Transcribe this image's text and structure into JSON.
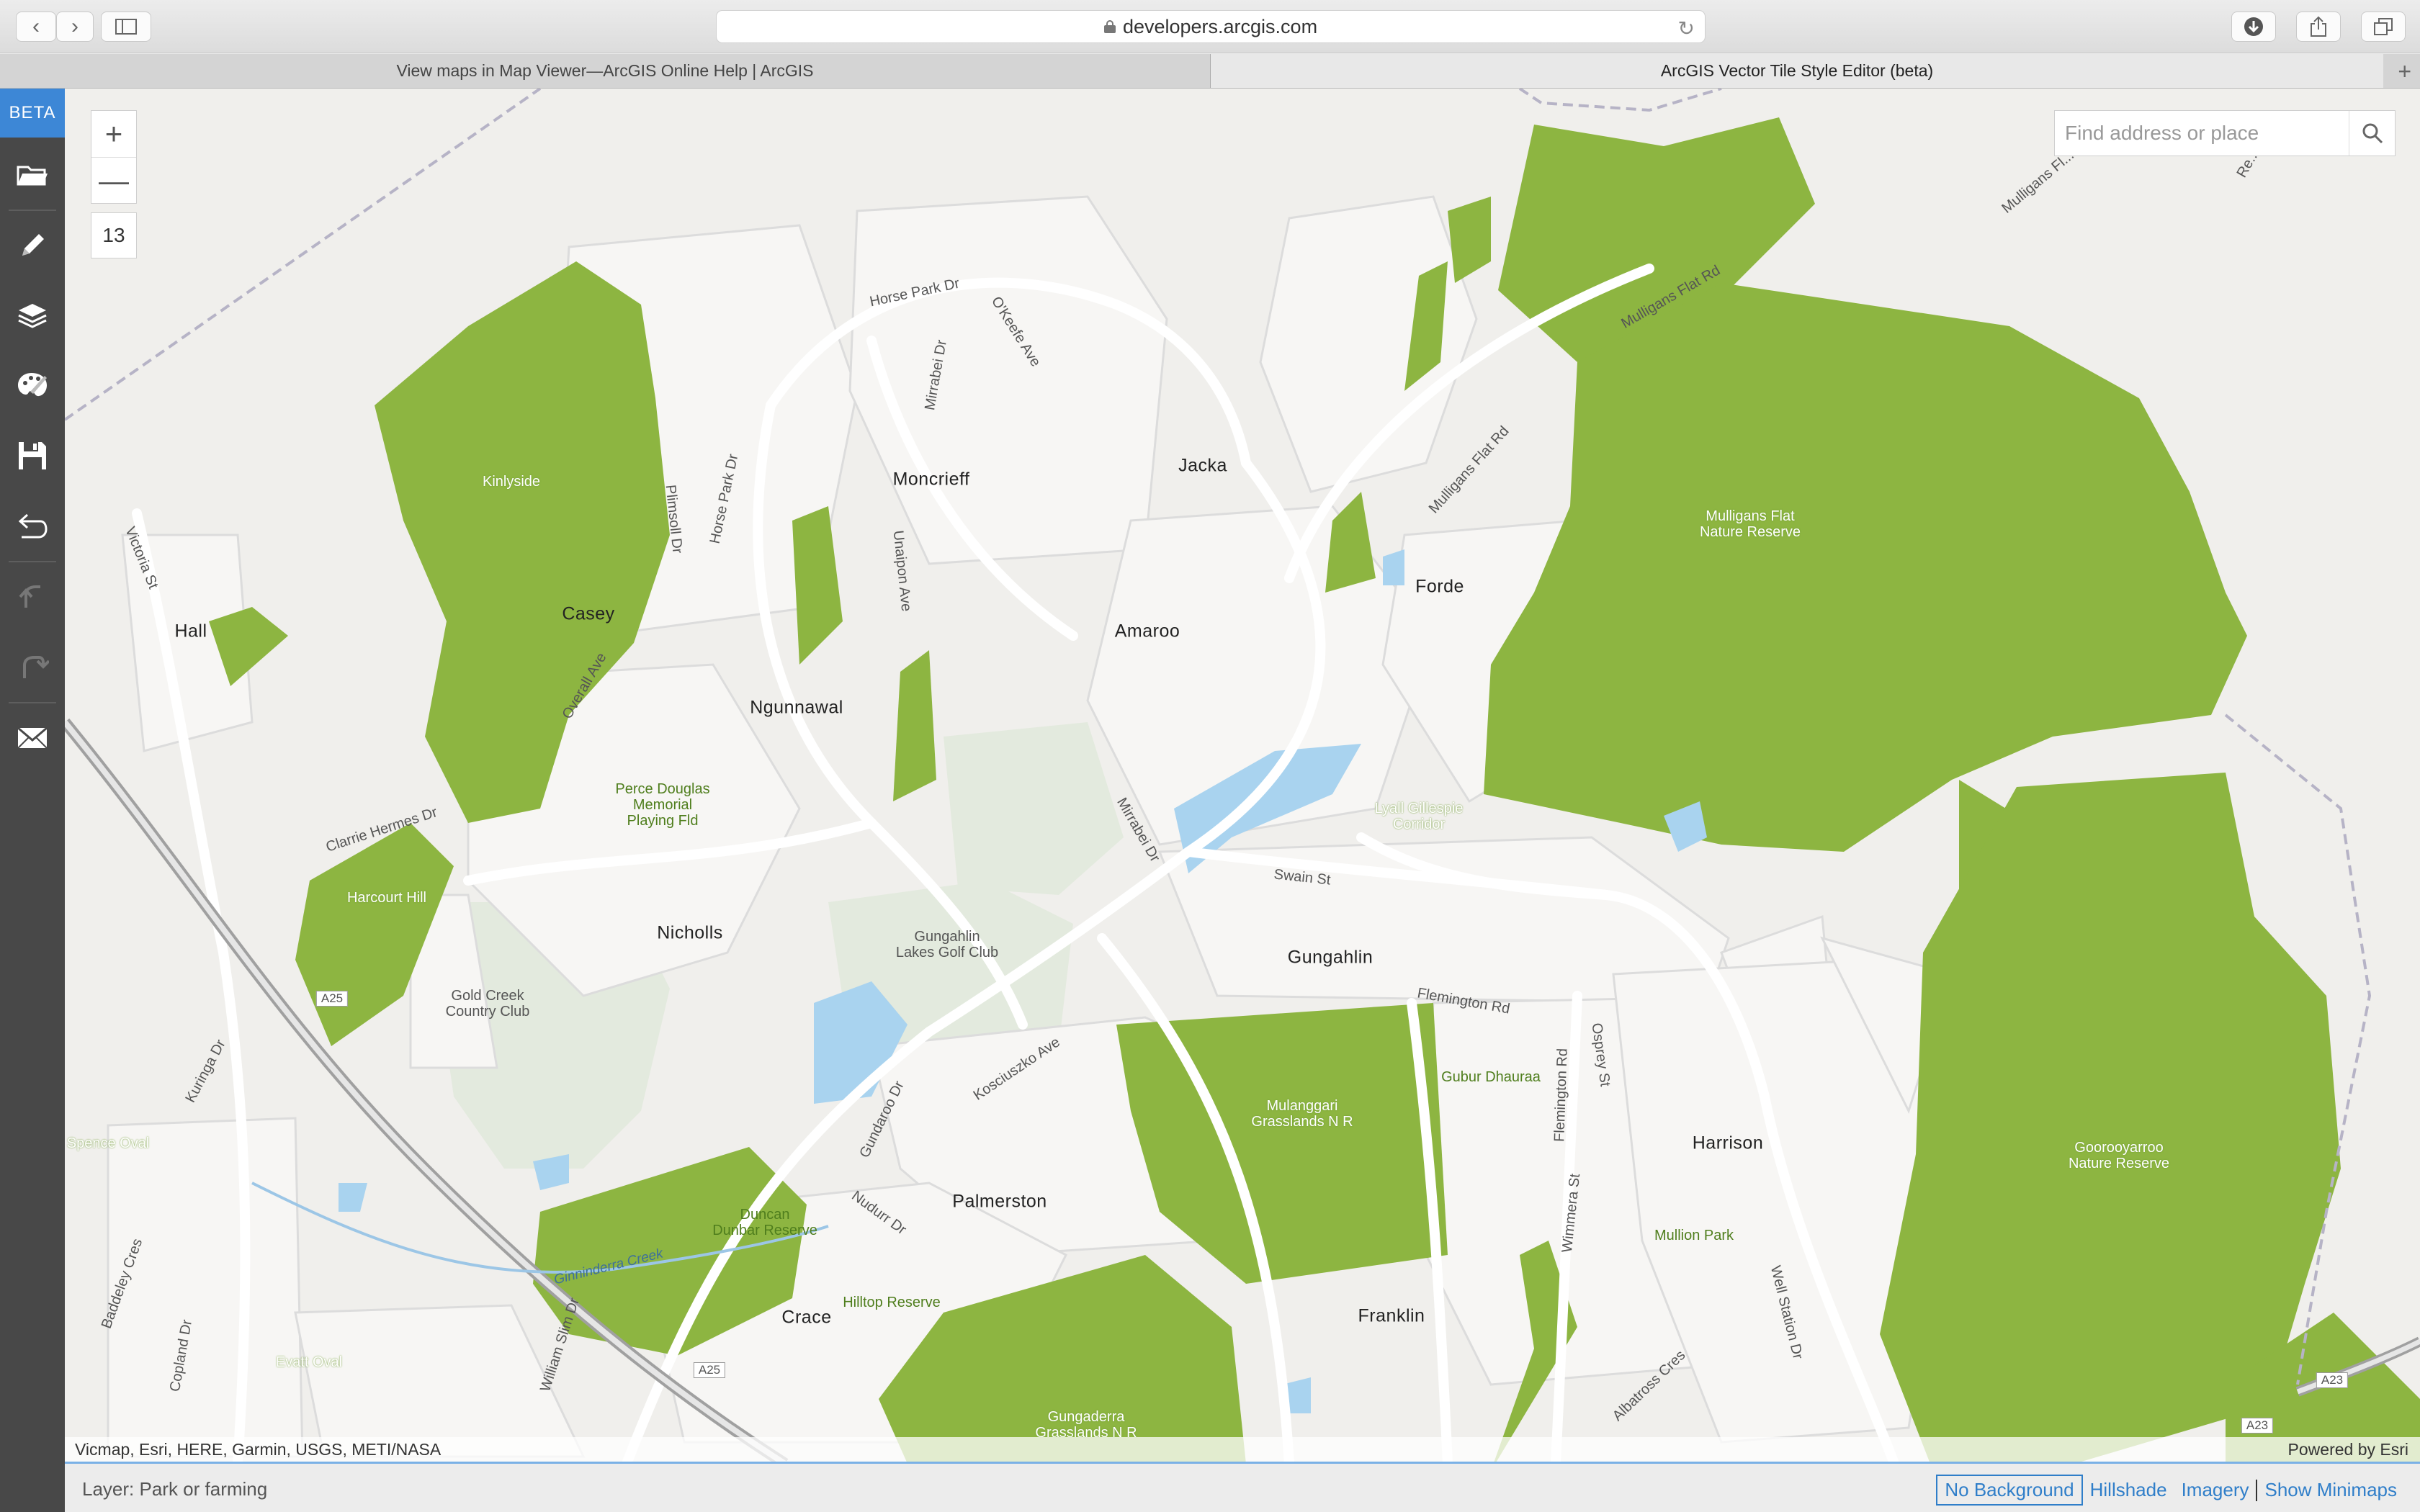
{
  "browser": {
    "url": "developers.arcgis.com",
    "tabs": [
      {
        "label": "View maps in Map Viewer—ArcGIS Online Help | ArcGIS"
      },
      {
        "label": "ArcGIS Vector Tile Style Editor (beta)"
      }
    ]
  },
  "sidebar": {
    "badge": "BETA",
    "tools": [
      "folder-icon",
      "pencil-icon",
      "layers-icon",
      "palette-icon",
      "save-icon",
      "exit-icon",
      "undo-icon",
      "redo-icon",
      "mail-icon"
    ]
  },
  "map": {
    "zoom_in": "+",
    "zoom_out": "—",
    "zoom_level": "13",
    "search_placeholder": "Find address or place",
    "attribution_left": "Vicmap, Esri, HERE, Garmin, USGS, METI/NASA",
    "attribution_right": "Powered by Esri",
    "colors": {
      "park": "#8db541",
      "water": "#a9d3ef",
      "land": "#f0efec",
      "golf": "#e3eade",
      "road": "#ffffff"
    },
    "suburbs": [
      "Moncrieff",
      "Jacka",
      "Hall",
      "Casey",
      "Amaroo",
      "Forde",
      "Ngunnawal",
      "Nicholls",
      "Gungahlin",
      "Harrison",
      "Palmerston",
      "Crace",
      "Franklin"
    ],
    "parks": [
      "Kinlyside",
      "Mulligans Flat",
      "Nature Reserve",
      "Harcourt Hill",
      "Lyall Gillespie",
      "Corridor",
      "Mulanggari",
      "Grasslands N R",
      "Goorooyarroo",
      "Nature Reserve",
      "Gungaderra",
      "Grasslands N R",
      "Spence Oval",
      "Evatt Oval"
    ],
    "parks_dark": [
      "Perce Douglas",
      "Memorial",
      "Playing Fld",
      "Gubur Dhauraa",
      "Mullion Park",
      "Duncan",
      "Dunbar Reserve",
      "Hilltop Reserve"
    ],
    "pois": [
      "Gold Creek",
      "Country Club",
      "Gungahlin",
      "Lakes Golf Club"
    ],
    "roads": [
      "Horse Park Dr",
      "O'Keefe Ave",
      "Mirrabei Dr",
      "Mulligans Flat Rd",
      "Mulligans Flat Rd",
      "Victoria St",
      "Plimsoll Dr",
      "Horse Park Dr",
      "Unaipon Ave",
      "Overall Ave",
      "Clarrie Hermes Dr",
      "Kuringa Dr",
      "Mirrabei Dr",
      "Swain St",
      "Flemington Rd",
      "Kosciuszko Ave",
      "Gundaroo Dr",
      "Nudurr Dr",
      "Flemington Rd",
      "Osprey St",
      "Wimmera St",
      "William Slim Dr",
      "Copland Dr",
      "Baddeley Cres",
      "Albatross Cres",
      "Well Station Dr",
      "Mulligans Fl...",
      "Re..."
    ],
    "shields": [
      "A25",
      "A25",
      "A23",
      "A23"
    ],
    "water_labels": [
      "Ginninderra Creek"
    ]
  },
  "status": {
    "layer": "Layer: Park or farming",
    "basemaps": {
      "none": "No Background",
      "hillshade": "Hillshade",
      "imagery": "Imagery",
      "minimaps": "Show Minimaps"
    }
  }
}
